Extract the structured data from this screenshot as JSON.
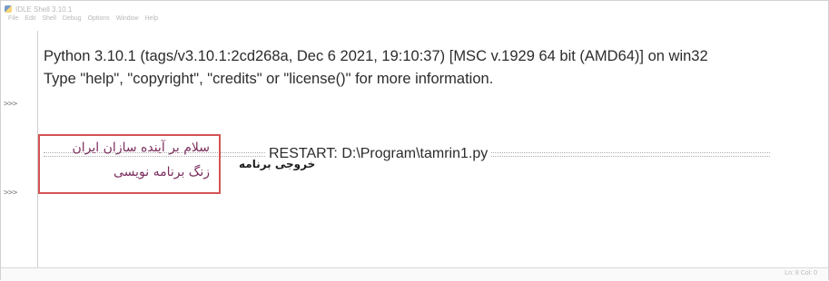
{
  "window": {
    "title": "IDLE Shell 3.10.1"
  },
  "menubar": {
    "items": [
      "File",
      "Edit",
      "Shell",
      "Debug",
      "Options",
      "Window",
      "Help"
    ]
  },
  "shell": {
    "banner_line1": "Python 3.10.1 (tags/v3.10.1:2cd268a, Dec  6 2021, 19:10:37) [MSC v.1929 64 bit (AMD64)] on win32",
    "banner_line2": "Type \"help\", \"copyright\", \"credits\" or \"license()\" for more information.",
    "prompt": ">>>",
    "restart_text": "RESTART: D:\\Program\\tamrin1.py",
    "output_lines": [
      "سلام بر آینده سازان ایران",
      "زنگ برنامه نویسی"
    ]
  },
  "annotation": {
    "label": "خروجی برنامه"
  },
  "statusbar": {
    "position": "Ln: 8  Col: 0"
  },
  "colors": {
    "output_text": "#7b2f5e",
    "highlight_border": "#d45454",
    "shell_text": "#2c2c2c"
  }
}
